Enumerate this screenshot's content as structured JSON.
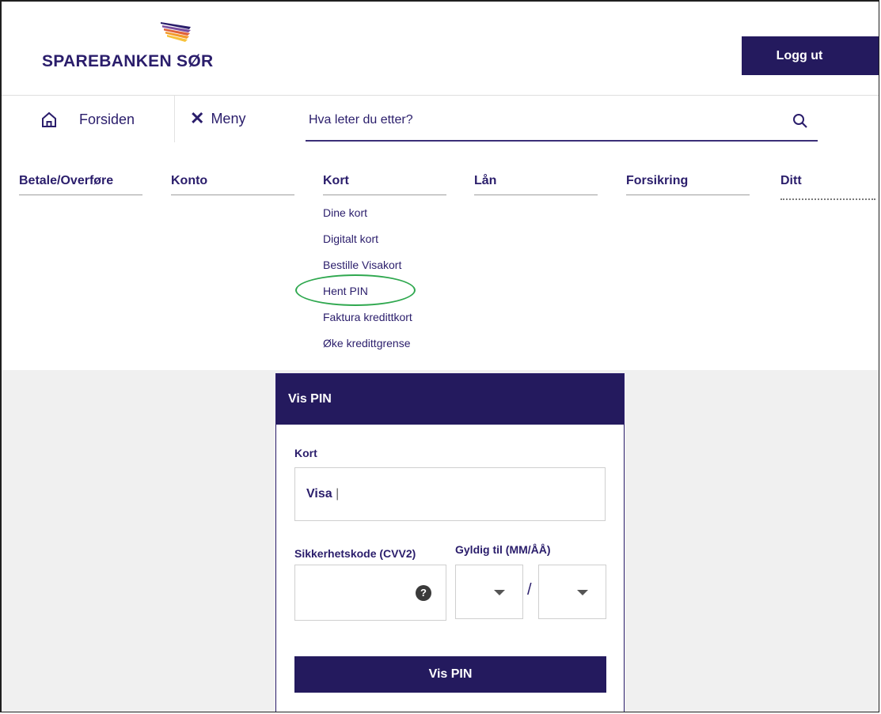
{
  "brand": {
    "name": "SPAREBANKEN SØR",
    "logo_icon": "stripes-logo-icon",
    "colors": {
      "primary": "#241a5e",
      "annotation": "#2fa84f"
    }
  },
  "header": {
    "logout_label": "Logg ut"
  },
  "topnav": {
    "home_label": "Forsiden",
    "home_icon": "home-icon",
    "menu_label": "Meny",
    "menu_icon": "close-icon",
    "search_placeholder": "Hva leter du etter?",
    "search_icon": "search-icon"
  },
  "categories": [
    {
      "label": "Betale/Overføre",
      "items": []
    },
    {
      "label": "Konto",
      "items": []
    },
    {
      "label": "Kort",
      "items": [
        "Dine kort",
        "Digitalt kort",
        "Bestille Visakort",
        "Hent PIN",
        "Faktura kredittkort",
        "Øke kredittgrense"
      ]
    },
    {
      "label": "Lån",
      "items": []
    },
    {
      "label": "Forsikring",
      "items": []
    },
    {
      "label": "Ditt",
      "items": []
    }
  ],
  "form": {
    "title": "Vis PIN",
    "card_label": "Kort",
    "card_value": "Visa",
    "cvv_label": "Sikkerhetskode (CVV2)",
    "cvv_help": "?",
    "expiry_label": "Gyldig til (MM/ÅÅ)",
    "expiry_separator": "/",
    "submit_label": "Vis PIN"
  }
}
